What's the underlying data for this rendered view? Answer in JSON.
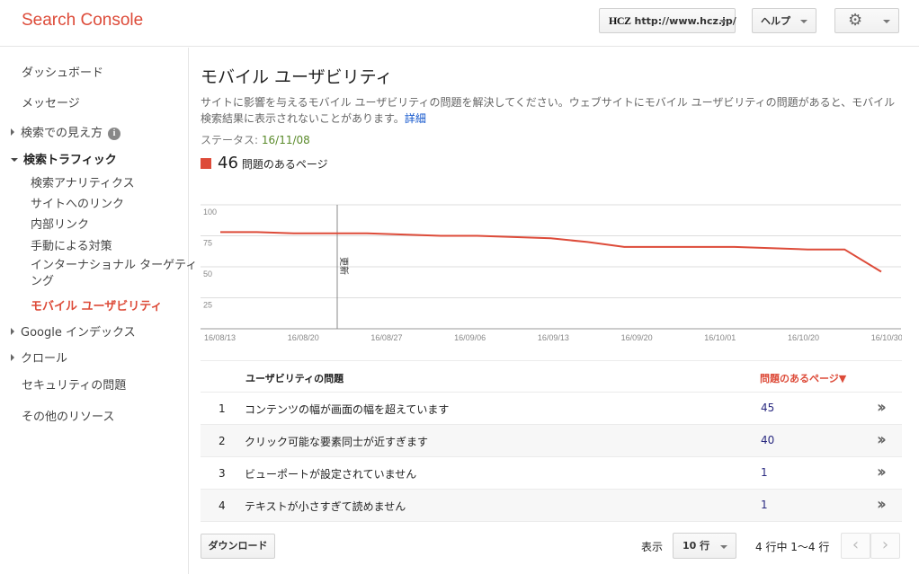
{
  "header": {
    "app_title": "Search Console",
    "site_logo_text": "HCZ",
    "site_url": "http://www.hcz.jp/",
    "help_label": "ヘルプ"
  },
  "sidebar": {
    "items": [
      {
        "label": "ダッシュボード"
      },
      {
        "label": "メッセージ"
      },
      {
        "label": "検索での見え方"
      },
      {
        "label": "検索トラフィック"
      },
      {
        "label": "検索アナリティクス"
      },
      {
        "label": "サイトへのリンク"
      },
      {
        "label": "内部リンク"
      },
      {
        "label": "手動による対策"
      },
      {
        "label_line1": "インターナショナル ターゲティ",
        "label_line2": "ング"
      },
      {
        "label": "モバイル ユーザビリティ"
      },
      {
        "label": "Google インデックス"
      },
      {
        "label": "クロール"
      },
      {
        "label": "セキュリティの問題"
      },
      {
        "label": "その他のリソース"
      }
    ]
  },
  "main": {
    "title": "モバイル ユーザビリティ",
    "description": "サイトに影響を与えるモバイル ユーザビリティの問題を解決してください。ウェブサイトにモバイル ユーザビリティの問題があると、モバイル検索結果に表示されないことがあります。",
    "details_link": "詳細",
    "status_label": "ステータス:",
    "status_value": "16/11/08",
    "legend_count": "46",
    "legend_label": "問題のあるページ",
    "accent_color": "#dd4b39"
  },
  "chart_data": {
    "type": "line",
    "ylim": [
      0,
      100
    ],
    "y_ticks": [
      100,
      75,
      50,
      25
    ],
    "x_tick_labels": [
      "16/08/13",
      "16/08/20",
      "16/08/27",
      "16/09/06",
      "16/09/13",
      "16/09/20",
      "16/10/01",
      "16/10/20",
      "16/10/30"
    ],
    "annotation": "更新",
    "series": [
      {
        "color": "#dd4b39",
        "values": [
          78,
          78,
          77,
          77,
          77,
          76,
          75,
          75,
          74,
          73,
          70,
          66,
          66,
          66,
          66,
          65,
          64,
          64,
          46
        ]
      }
    ]
  },
  "table": {
    "col_issue": "ユーザビリティの問題",
    "col_pages": "問題のあるページ▼",
    "rows": [
      {
        "index": "1",
        "issue": "コンテンツの幅が画面の幅を超えています",
        "count": "45"
      },
      {
        "index": "2",
        "issue": "クリック可能な要素同士が近すぎます",
        "count": "40"
      },
      {
        "index": "3",
        "issue": "ビューポートが設定されていません",
        "count": "1"
      },
      {
        "index": "4",
        "issue": "テキストが小さすぎて読めません",
        "count": "1"
      }
    ]
  },
  "footer": {
    "download_label": "ダウンロード",
    "show_label": "表示",
    "rows_value": "10 行",
    "range_text": "4 行中 1～4 行"
  }
}
